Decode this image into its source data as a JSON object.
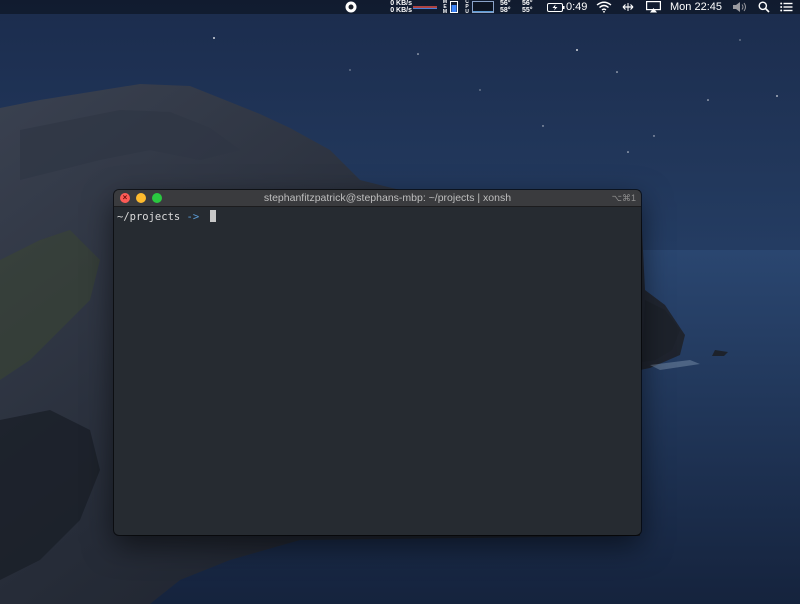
{
  "menubar": {
    "net_up": "0 KB/s",
    "net_down": "0 KB/s",
    "mem_label": [
      "M",
      "E",
      "M"
    ],
    "cpu_label": [
      "C",
      "P",
      "U"
    ],
    "temp_col1": [
      "56°",
      "58°"
    ],
    "temp_col2": [
      "56°",
      "55°"
    ],
    "battery_time": "0:49",
    "clock": "Mon 22:45"
  },
  "terminal": {
    "title": "stephanfitzpatrick@stephans-mbp: ~/projects | xonsh",
    "shortcut": "⌥⌘1",
    "prompt_path": "~/projects",
    "prompt_arrow": "->"
  },
  "colors": {
    "close": "#fd5b56",
    "minimize": "#febb2e",
    "zoom": "#2ac840",
    "terminal_bg": "#262b31",
    "prompt_arrow": "#5b9bd5"
  }
}
